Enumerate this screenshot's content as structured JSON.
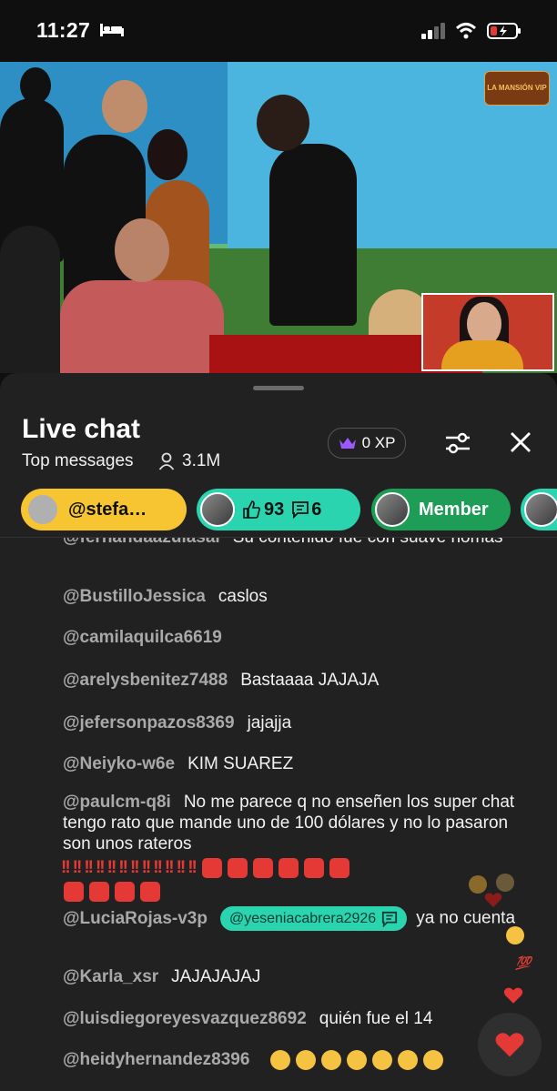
{
  "status_bar": {
    "time": "11:27"
  },
  "video": {
    "logo_text": "LA MANSIÓN VIP"
  },
  "chat": {
    "title": "Live chat",
    "subtitle": "Top messages",
    "viewer_count": "3.1M",
    "xp_label": "0 XP"
  },
  "chips": {
    "user": "@stefa…",
    "likes": "93",
    "comments": "6",
    "member": "Member"
  },
  "messages": [
    {
      "author": "@fernandaazulasal",
      "text": "Su contenido fue con suave nomas"
    },
    {
      "author": "@BustilloJessica",
      "text": "caslos"
    },
    {
      "author": "@camilaquilca6619",
      "text": ""
    },
    {
      "author": "@arelysbenitez7488",
      "text": "Bastaaaa JAJAJA"
    },
    {
      "author": "@jefersonpazos8369",
      "text": "jajajja"
    },
    {
      "author": "@Neiyko-w6e",
      "text": "KIM SUAREZ"
    },
    {
      "author": "@paulcm-q8i",
      "text": "No me parece q no enseñen los super chat tengo rato que mande uno de 100 dólares y no lo pasaron son unos rateros"
    },
    {
      "author": "@LuciaRojas-v3p",
      "mention": "@yeseniacabrera2926",
      "text": "ya no cuenta"
    },
    {
      "author": "@Karla_xsr",
      "text": "JAJAJAJAJ"
    },
    {
      "author": "@luisdiegoreyesvazquez8692",
      "text": "quién fue el 14"
    },
    {
      "author": "@heidyhernandez8396",
      "text": ""
    }
  ],
  "colors": {
    "background": "#0f0f0f",
    "sheet": "#212121",
    "chip_user": "#f6c531",
    "chip_stats": "#2ad4ae",
    "chip_member": "#1e9d57",
    "alarm": "#e53935"
  }
}
